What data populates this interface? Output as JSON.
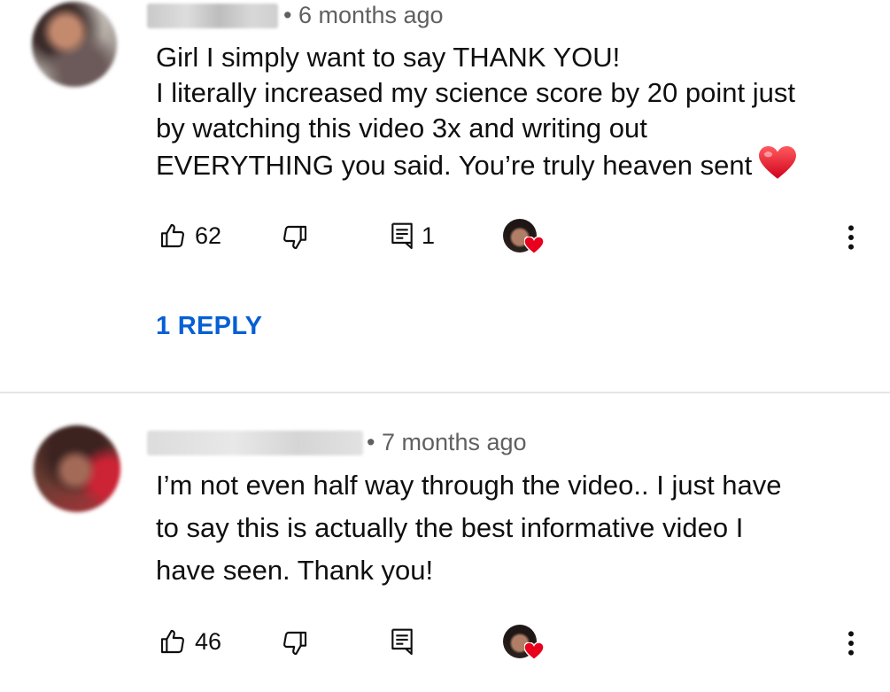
{
  "comments": [
    {
      "timestamp": "• 6 months ago",
      "body_lines": [
        "Girl I simply want to say THANK YOU!",
        "I literally increased my science score by 20 point just",
        "by watching this video 3x and writing out",
        "EVERYTHING you said. You’re truly heaven sent"
      ],
      "emoji": "heart-emoji",
      "likes": "62",
      "reply_count": "1",
      "creator_heart": true,
      "replies_link": "1 REPLY"
    },
    {
      "timestamp": "• 7 months ago",
      "body_lines": [
        "I’m not even half way through the video.. I just have",
        "to say this is actually the best informative video I",
        "have seen. Thank you!"
      ],
      "likes": "46",
      "reply_count": "",
      "creator_heart": true
    }
  ],
  "icons": {
    "like": "thumbs-up-icon",
    "dislike": "thumbs-down-icon",
    "reply": "comment-reply-icon",
    "more": "more-vertical-icon",
    "creator_heart": "heart-icon"
  },
  "colors": {
    "link": "#065fd4",
    "heart": "#e8001c",
    "secondary_text": "#606060",
    "divider": "#e5e5e5"
  }
}
